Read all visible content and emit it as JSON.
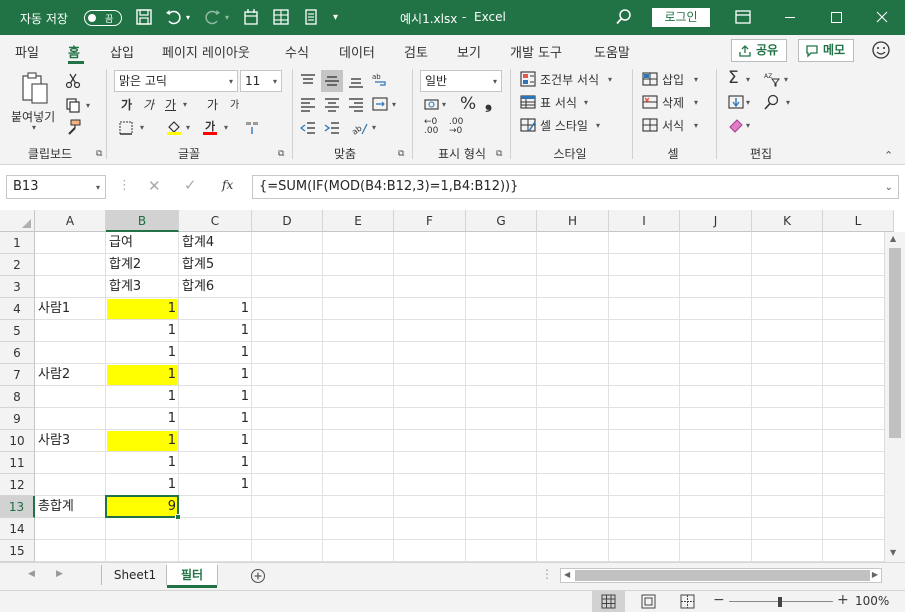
{
  "titlebar": {
    "autosave_label": "자동 저장",
    "autosave_state": "끔",
    "filename": "예시1.xlsx",
    "separator": "-",
    "app": "Excel",
    "login": "로그인"
  },
  "tabs": [
    "파일",
    "홈",
    "삽입",
    "페이지 레이아웃",
    "수식",
    "데이터",
    "검토",
    "보기",
    "개발 도구",
    "도움말"
  ],
  "active_tab": "홈",
  "share_label": "공유",
  "memo_label": "메모",
  "ribbon": {
    "clipboard": {
      "label": "클립보드",
      "paste": "붙여넣기"
    },
    "font": {
      "label": "글꼴",
      "font_name": "맑은 고딕",
      "font_size": "11",
      "bold": "가",
      "italic": "가",
      "underline": "가",
      "grow": "가",
      "shrink": "가"
    },
    "align": {
      "label": "맞춤"
    },
    "number": {
      "label": "표시 형식",
      "format": "일반"
    },
    "styles": {
      "label": "스타일",
      "cond": "조건부 서식",
      "table": "표 서식",
      "cell": "셀 스타일"
    },
    "cells": {
      "label": "셀",
      "insert": "삽입",
      "delete": "삭제",
      "format": "서식"
    },
    "edit": {
      "label": "편집"
    }
  },
  "formula_bar": {
    "name_box": "B13",
    "fx": "fx",
    "formula": "{=SUM(IF(MOD(B4:B12,3)=1,B4:B12))}"
  },
  "columns": [
    "A",
    "B",
    "C",
    "D",
    "E",
    "F",
    "G",
    "H",
    "I",
    "J",
    "K",
    "L"
  ],
  "rows": [
    "1",
    "2",
    "3",
    "4",
    "5",
    "6",
    "7",
    "8",
    "9",
    "10",
    "11",
    "12",
    "13",
    "14",
    "15"
  ],
  "cells": {
    "B1": "급여",
    "C1": "합계4",
    "B2": "합계2",
    "C2": "합계5",
    "B3": "합계3",
    "C3": "합계6",
    "A4": "사람1",
    "B4": "1",
    "C4": "1",
    "B5": "1",
    "C5": "1",
    "B6": "1",
    "C6": "1",
    "A7": "사람2",
    "B7": "1",
    "C7": "1",
    "B8": "1",
    "C8": "1",
    "B9": "1",
    "C9": "1",
    "A10": "사람3",
    "B10": "1",
    "C10": "1",
    "B11": "1",
    "C11": "1",
    "B12": "1",
    "C12": "1",
    "A13": "총합계",
    "B13": "9"
  },
  "highlight_color": "#FFFF00",
  "accent_color": "#217346",
  "sheets": [
    "Sheet1",
    "필터"
  ],
  "active_sheet": "필터",
  "zoom": "100%"
}
